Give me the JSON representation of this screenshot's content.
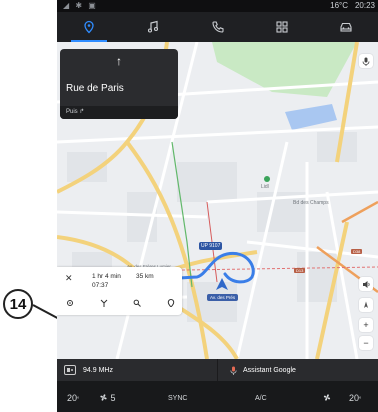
{
  "callout": {
    "number": "14"
  },
  "statusbar": {
    "temperature": "16°C",
    "time": "20:23"
  },
  "topnav": {
    "items": [
      {
        "icon": "location-pin-icon",
        "active": true
      },
      {
        "icon": "music-note-icon",
        "active": false
      },
      {
        "icon": "phone-icon",
        "active": false
      },
      {
        "icon": "apps-grid-icon",
        "active": false
      },
      {
        "icon": "car-icon",
        "active": false
      }
    ],
    "accent_color": "#2f8cff"
  },
  "navigation": {
    "turn_arrow": "↑",
    "street": "Rue de Paris",
    "then_label": "Puis ↱"
  },
  "map": {
    "labels": {
      "park": "Lidl",
      "street_1": "Bd des Champs",
      "street_2": "Av. des Frères Lumier",
      "destination": "Av. des Prés",
      "route_badge": "UP 9107",
      "road_a": "D13",
      "road_b": "D38"
    },
    "controls": {
      "mic": "🎤",
      "volume": "◀)",
      "zoom_in": "+",
      "zoom_out": "−"
    }
  },
  "trip": {
    "close": "✕",
    "duration": "1 hr 4 min",
    "distance": "35 km",
    "eta": "07:37",
    "tools": [
      "settings-icon",
      "route-split-icon",
      "search-icon",
      "location-icon"
    ]
  },
  "media": {
    "station": "94.9 MHz",
    "assistant": "Assistant Google"
  },
  "climate": {
    "left_temp": "20",
    "fan_level": "5",
    "sync": "SYNC",
    "ac": "A/C",
    "right_temp": "20"
  }
}
